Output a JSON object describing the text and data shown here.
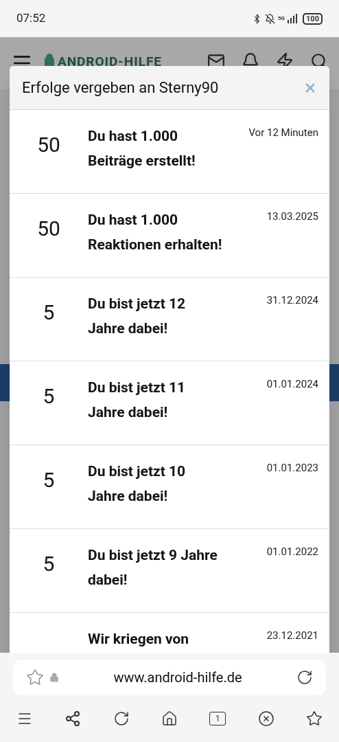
{
  "status_bar": {
    "time": "07:52",
    "battery": "100",
    "network": "5G"
  },
  "site_header": {
    "logo": "ANDROID-HILFE"
  },
  "dialog": {
    "title": "Erfolge vergeben an Sterny90",
    "items": [
      {
        "points": "50",
        "title": "Du hast 1.000 Beiträge erstellt!",
        "date": "Vor 12 Minuten"
      },
      {
        "points": "50",
        "title": "Du hast 1.000 Reaktionen erhalten!",
        "date": "13.03.2025"
      },
      {
        "points": "5",
        "title": "Du bist jetzt 12 Jahre dabei!",
        "date": "31.12.2024"
      },
      {
        "points": "5",
        "title": "Du bist jetzt 11 Jahre dabei!",
        "date": "01.01.2024"
      },
      {
        "points": "5",
        "title": "Du bist jetzt 10 Jahre dabei!",
        "date": "01.01.2023"
      },
      {
        "points": "5",
        "title": "Du bist jetzt 9 Jahre dabei!",
        "date": "01.01.2022"
      },
      {
        "title": "Wir kriegen von",
        "date": "23.12.2021"
      }
    ]
  },
  "browser": {
    "url": "www.android-hilfe.de",
    "tab_count": "1"
  }
}
